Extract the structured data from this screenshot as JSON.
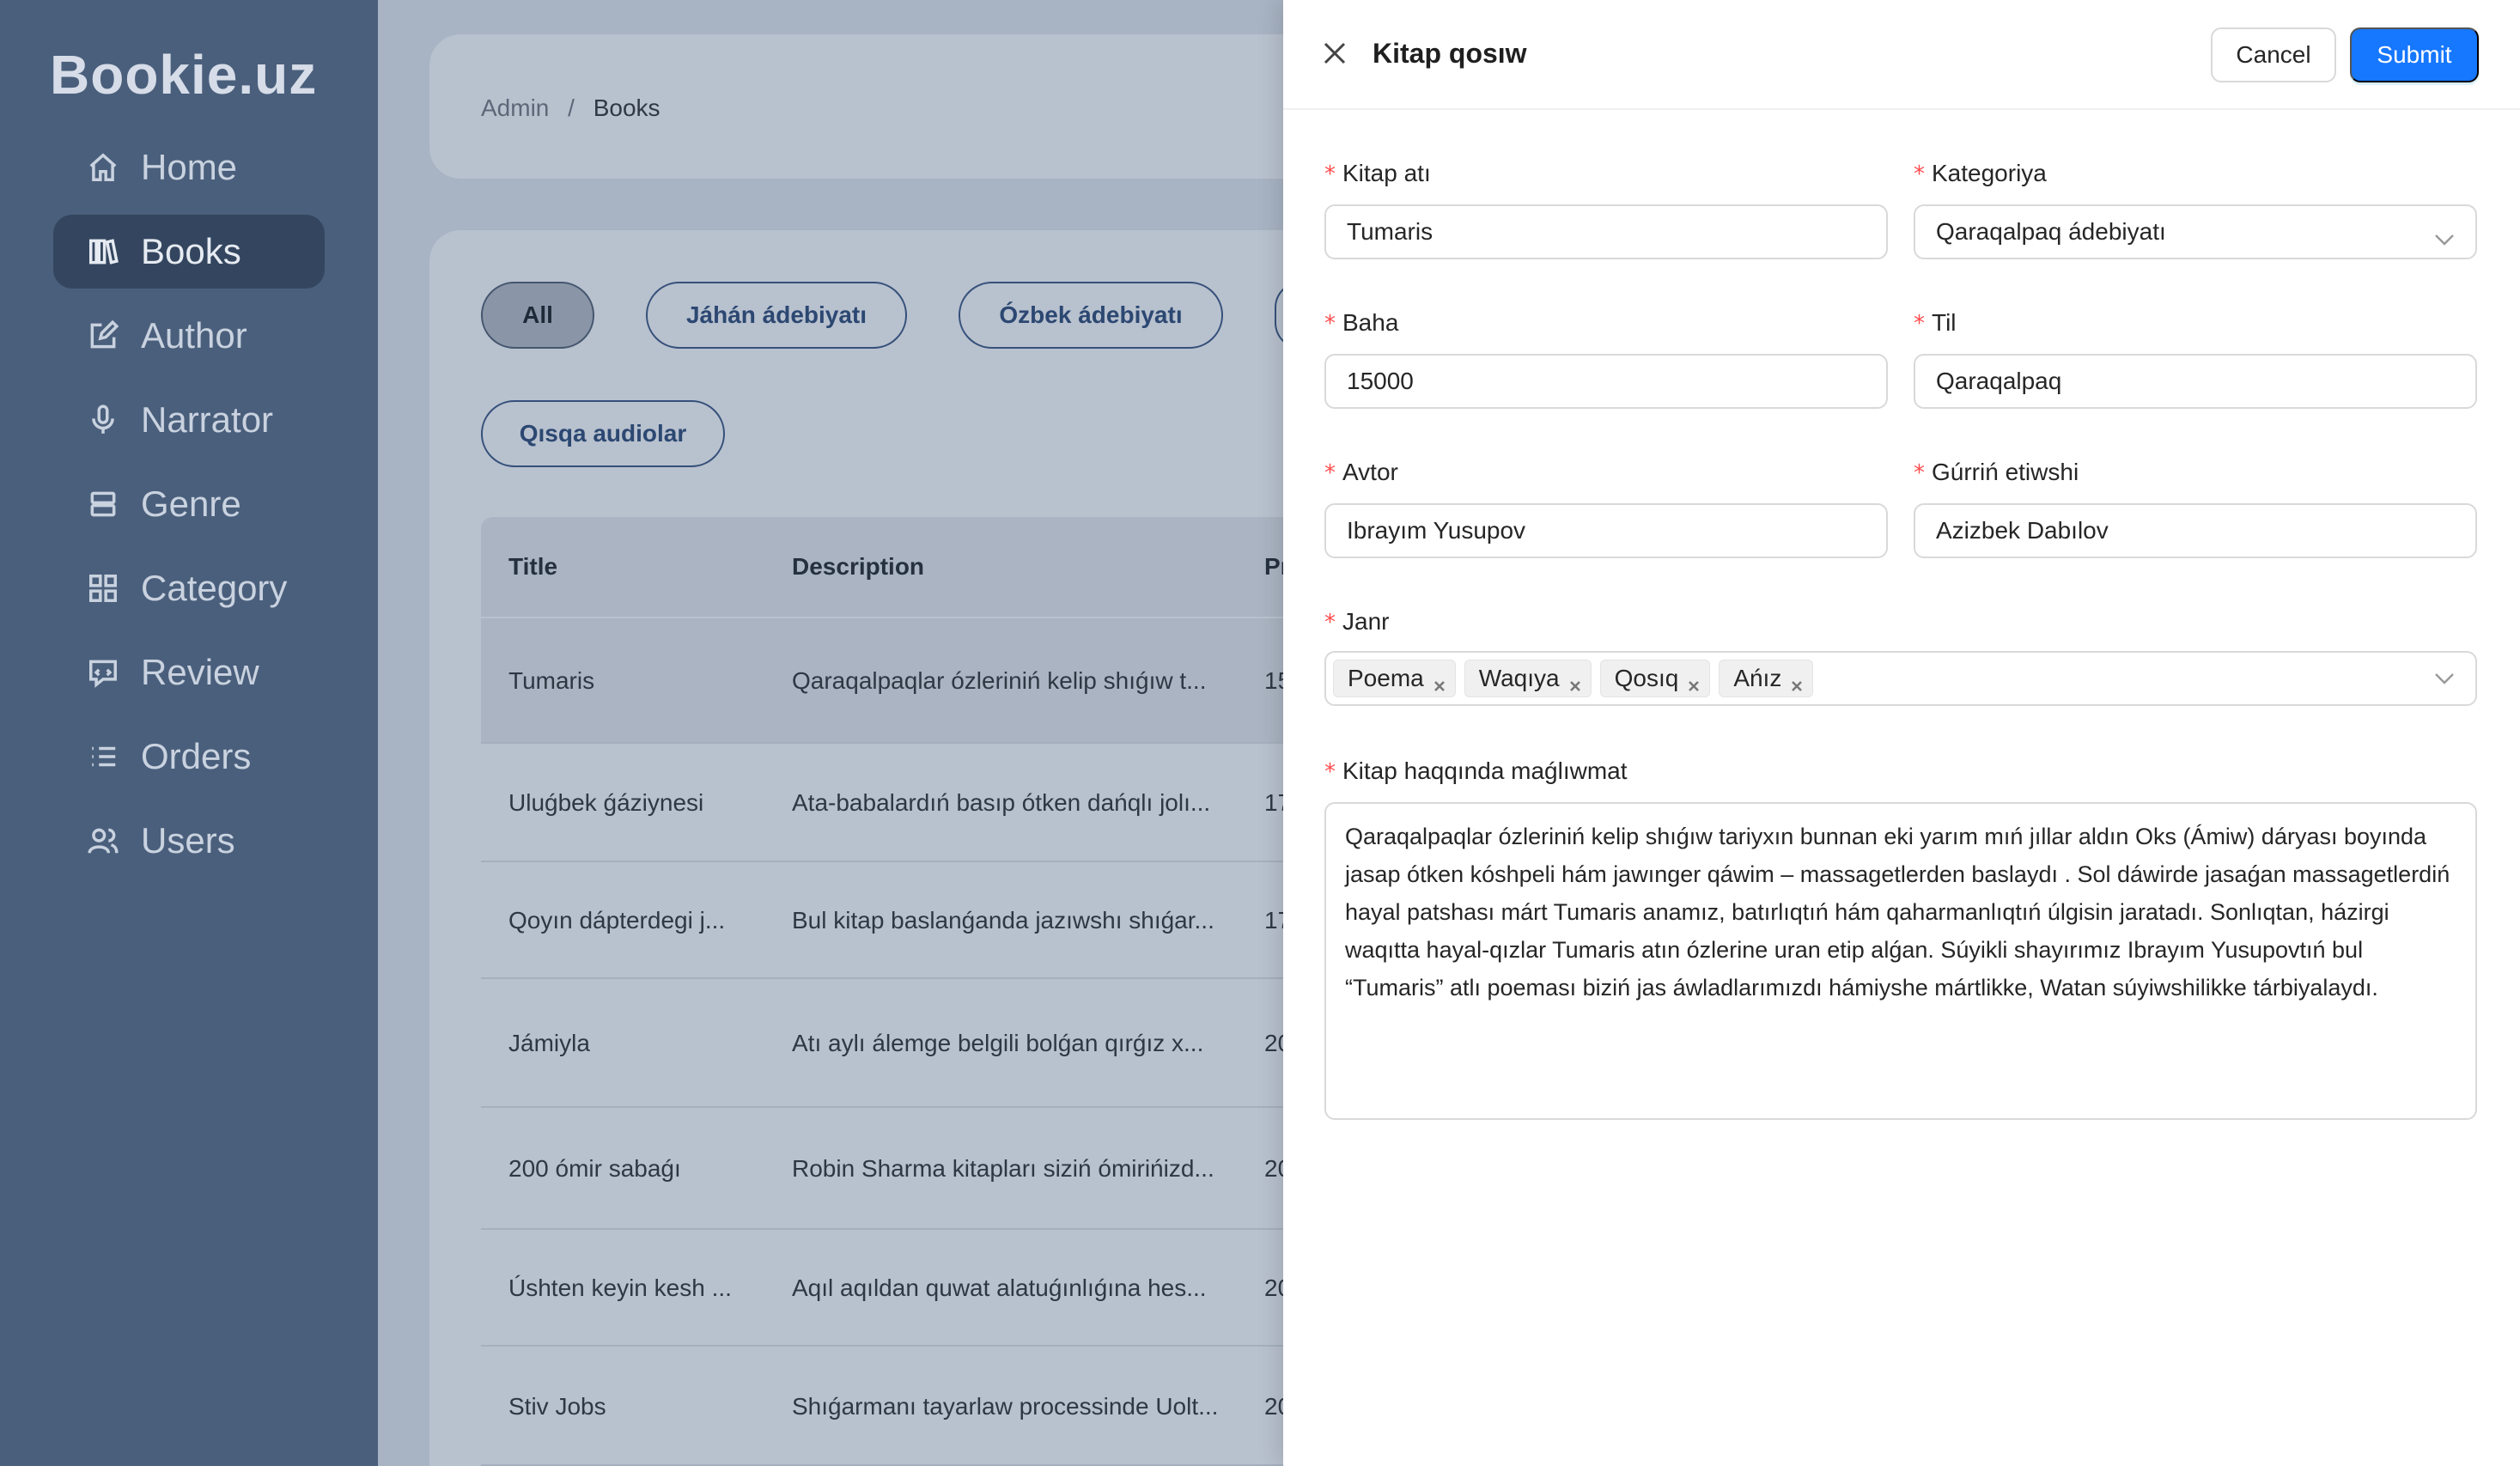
{
  "app": {
    "logo": "Bookie.uz"
  },
  "sidebar": {
    "items": [
      {
        "label": "Home",
        "icon": "home-icon"
      },
      {
        "label": "Books",
        "icon": "book-icon",
        "active": true
      },
      {
        "label": "Author",
        "icon": "edit-icon"
      },
      {
        "label": "Narrator",
        "icon": "microphone-icon"
      },
      {
        "label": "Genre",
        "icon": "database-icon"
      },
      {
        "label": "Category",
        "icon": "grid-icon"
      },
      {
        "label": "Review",
        "icon": "message-icon"
      },
      {
        "label": "Orders",
        "icon": "list-icon"
      },
      {
        "label": "Users",
        "icon": "users-icon"
      }
    ]
  },
  "breadcrumb": {
    "root": "Admin",
    "separator": "/",
    "current": "Books"
  },
  "filters": [
    "All",
    "Jáhán ádebiyatı",
    "Ózbek ádebiyatı",
    "Qısqa audiolar"
  ],
  "table": {
    "columns": [
      "Title",
      "Description",
      "Pr"
    ],
    "rows": [
      {
        "title": "Tumaris",
        "description": "Qaraqalpaqlar ózleriniń kelip shıǵıw t...",
        "price": "15"
      },
      {
        "title": "Uluǵbek ǵáziynesi",
        "description": "Ata-babalardıń basıp ótken dańqlı jolı...",
        "price": "17"
      },
      {
        "title": "Qoyın dápterdegi j...",
        "description": "Bul kitap baslanǵanda jazıwshı shıǵar...",
        "price": "17"
      },
      {
        "title": "Jámiyla",
        "description": "Atı aylı álemge belgili bolǵan qırǵız x...",
        "price": "20"
      },
      {
        "title": "200 ómir sabaǵı",
        "description": "Robin Sharma kitapları siziń ómirińizd...",
        "price": "20"
      },
      {
        "title": "Úshten keyin kesh ...",
        "description": "Aqıl aqıldan quwat alatuǵınlıǵına hes...",
        "price": "20"
      },
      {
        "title": "Stiv Jobs",
        "description": "Shıǵarmanı tayarlaw processinde Uolt...",
        "price": "20"
      }
    ]
  },
  "drawer": {
    "title": "Kitap qosıw",
    "cancel_label": "Cancel",
    "submit_label": "Submit",
    "required_mark": "*",
    "fields": {
      "name": {
        "label": "Kitap atı",
        "value": "Tumaris"
      },
      "category": {
        "label": "Kategoriya",
        "value": "Qaraqalpaq ádebiyatı"
      },
      "price": {
        "label": "Baha",
        "value": "15000"
      },
      "language": {
        "label": "Til",
        "value": "Qaraqalpaq"
      },
      "author": {
        "label": "Avtor",
        "value": "Ibrayım Yusupov"
      },
      "narrator": {
        "label": "Gúrriń etiwshi",
        "value": "Azizbek Dabılov"
      },
      "genre": {
        "label": "Janr",
        "tags": [
          "Poema",
          "Waqıya",
          "Qosıq",
          "Ańız"
        ]
      },
      "description": {
        "label": "Kitap haqqında maǵlıwmat",
        "value": "Qaraqalpaqlar ózleriniń kelip shıǵıw tariyxın bunnan eki yarım mıń jıllar aldın Oks (Ámiw) dáryası boyında jasap ótken kóshpeli hám jawınger qáwim – massagetlerden baslaydı . Sol dáwirde jasaǵan massagetlerdiń hayal patshası márt Tumaris anamız, batırlıqtıń hám qaharmanlıqtıń úlgisin jaratadı. Sonlıqtan, házirgi waqıtta hayal-qızlar Tumaris atın ózlerine uran etip alǵan. Súyikli shayırımız Ibrayım Yusupovtıń bul “Tumaris” atlı poeması biziń jas áwladlarımızdı hámiyshe mártlikke, Watan súyiwshilikke tárbiyalaydı."
      }
    }
  },
  "colors": {
    "primary": "#1677ff",
    "required": "#ff4d4f",
    "sidebar": "#4a5f7c"
  }
}
